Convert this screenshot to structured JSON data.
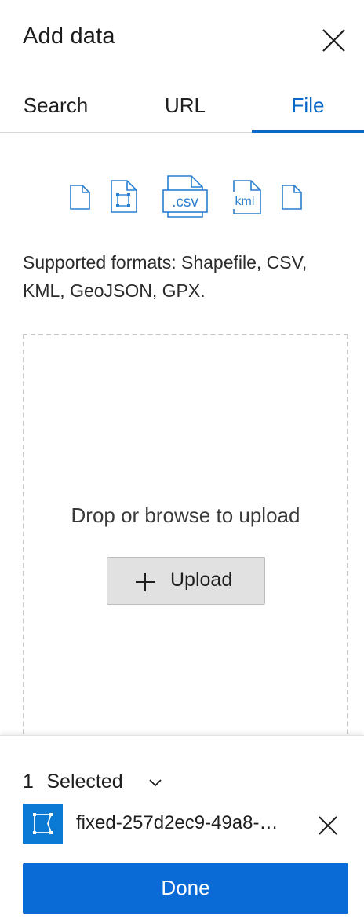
{
  "panel": {
    "title": "Add data"
  },
  "tabs": [
    {
      "label": "Search",
      "active": false
    },
    {
      "label": "URL",
      "active": false
    },
    {
      "label": "File",
      "active": true
    }
  ],
  "formats": {
    "icons": [
      "file-icon",
      "shapefile-icon",
      "csv-file-icon",
      "kml-file-icon",
      "file-icon"
    ],
    "csv_label": ".csv",
    "kml_label": "kml",
    "supported_text": "Supported formats: Shapefile, CSV, KML, GeoJSON, GPX."
  },
  "dropzone": {
    "prompt": "Drop or browse to upload",
    "upload_label": "Upload"
  },
  "selection": {
    "count": "1",
    "label": "Selected",
    "file_name": "fixed-257d2ec9-49a8-…"
  },
  "actions": {
    "done_label": "Done"
  },
  "colors": {
    "accent": "#0a69c7",
    "button_primary": "#0a6ad6",
    "file_icon_bg": "#0a7ad4"
  }
}
